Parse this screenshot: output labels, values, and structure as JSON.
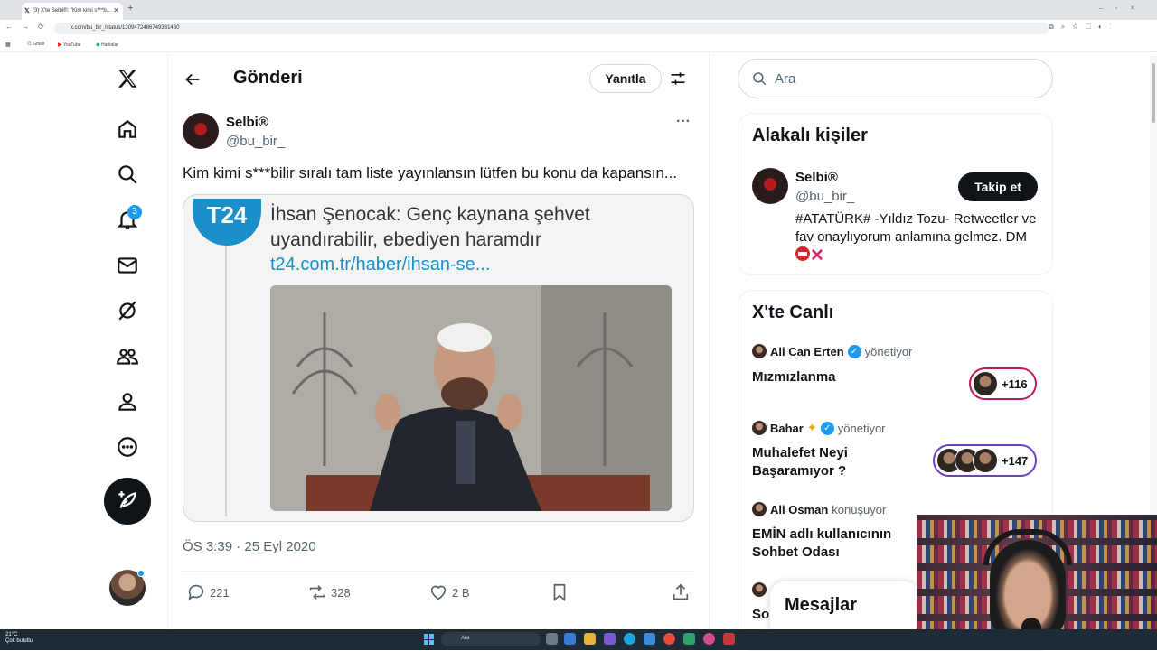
{
  "browser": {
    "tab_title": "(3) X'te Selbi®: \"Kim kimi s***b...",
    "url": "x.com/bu_bir_/status/1309472486749331460",
    "bookmarks": [
      "Gmail",
      "YouTube",
      "Haritalar"
    ]
  },
  "nav": {
    "notification_count": "3",
    "items": [
      "home",
      "explore",
      "notifications",
      "messages",
      "grok",
      "communities",
      "profile",
      "more"
    ]
  },
  "header": {
    "title": "Gönderi",
    "reply_label": "Yanıtla"
  },
  "post": {
    "author_name": "Selbi®",
    "author_handle": "@bu_bir_",
    "text": "Kim kimi s***bilir sıralı tam liste yayınlansın lütfen bu konu da kapansın...",
    "media": {
      "logo": "T24",
      "headline": "İhsan Şenocak: Genç kaynana şehvet uyandırabilir, ebediyen haramdır",
      "link": "t24.com.tr/haber/ihsan-se..."
    },
    "timestamp": "ÖS 3:39 · 25 Eyl 2020",
    "replies": "221",
    "reposts": "328",
    "likes": "2 B"
  },
  "search": {
    "placeholder": "Ara"
  },
  "related": {
    "title": "Alakalı kişiler",
    "name": "Selbi®",
    "handle": "@bu_bir_",
    "follow_label": "Takip et",
    "bio": "#ATATÜRK# -Yıldız Tozu- Retweetler ve fav onaylıyorum anlamına gelmez. DM"
  },
  "live": {
    "title": "X'te Canlı",
    "spaces": [
      {
        "host": "Ali Can Erten",
        "role": "yönetiyor",
        "topic": "Mızmızlanma",
        "listeners": "+116"
      },
      {
        "host": "Bahar",
        "role": "yönetiyor",
        "topic": "Muhalefet Neyi Başaramıyor ?",
        "listeners": "+147"
      },
      {
        "host": "Ali Osman",
        "role": "konuşuyor",
        "topic": "EMİN adlı kullanıcının Sohbet Odası"
      },
      {
        "topic": "So"
      }
    ]
  },
  "messages_label": "Mesajlar",
  "taskbar": {
    "temp": "21°C",
    "weather": "Çok bulutlu",
    "search_placeholder": "Ara"
  },
  "colors": {
    "accent": "#1d9bf0",
    "text": "#0f1419",
    "muted": "#536471",
    "t24_blue": "#1a8fc9"
  }
}
